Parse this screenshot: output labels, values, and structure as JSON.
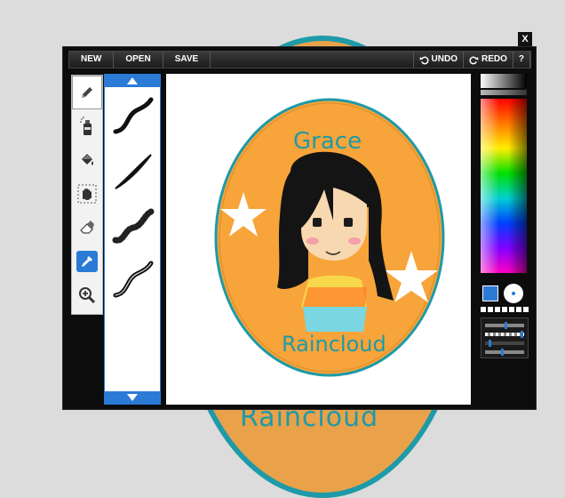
{
  "background": {
    "art_text": "Raincloud"
  },
  "window": {
    "close_label": "X"
  },
  "toolbar": {
    "new_label": "NEW",
    "open_label": "OPEN",
    "save_label": "SAVE",
    "undo_label": "UNDO",
    "redo_label": "REDO",
    "help_label": "?"
  },
  "tools": [
    {
      "name": "pencil-tool",
      "icon": "pencil-icon"
    },
    {
      "name": "spray-tool",
      "icon": "spray-can-icon"
    },
    {
      "name": "fill-tool",
      "icon": "paint-bucket-icon"
    },
    {
      "name": "pan-tool",
      "icon": "hand-icon"
    },
    {
      "name": "eraser-tool",
      "icon": "eraser-icon"
    },
    {
      "name": "color-picker-tool",
      "icon": "eyedropper-icon"
    },
    {
      "name": "zoom-tool",
      "icon": "zoom-in-icon"
    }
  ],
  "canvas": {
    "title_text": "Grace",
    "name_text": "Raincloud",
    "colors": {
      "circle": "#f7a43a",
      "ring": "#1e9aa8",
      "hair": "#141414",
      "skin": "#f8d8b0"
    }
  },
  "palette": {
    "primary_color": "#2b7bd6",
    "secondary_color": "#ffffff"
  }
}
